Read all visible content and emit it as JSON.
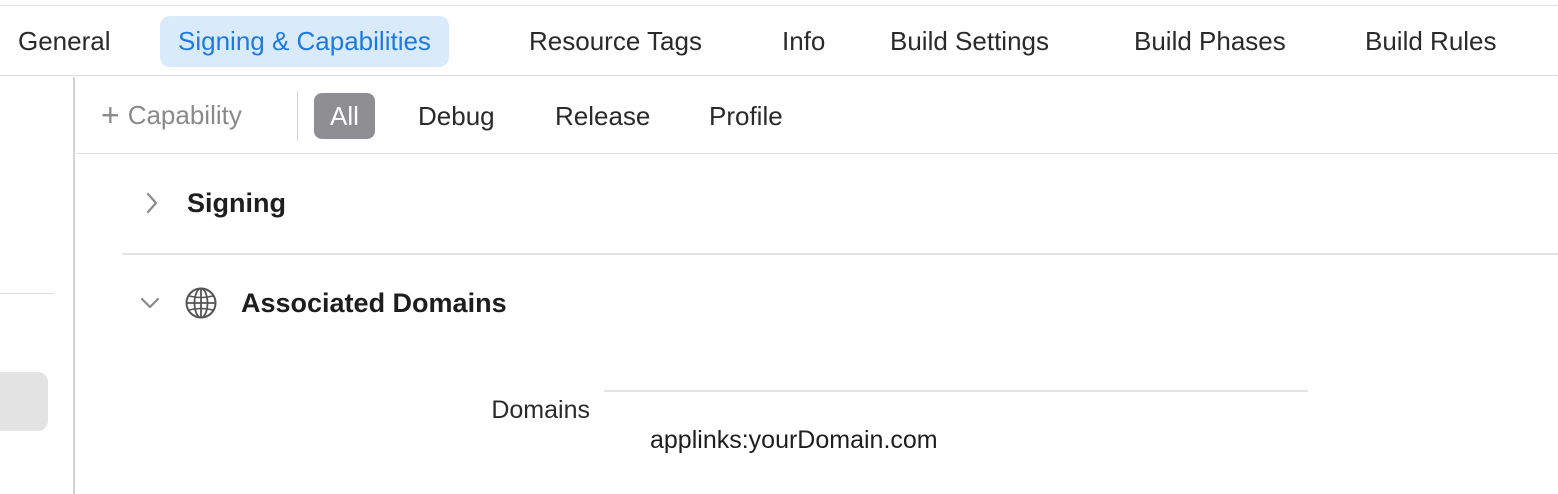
{
  "tabs": [
    {
      "label": "General",
      "active": false
    },
    {
      "label": "Signing & Capabilities",
      "active": true
    },
    {
      "label": "Resource Tags",
      "active": false
    },
    {
      "label": "Info",
      "active": false
    },
    {
      "label": "Build Settings",
      "active": false
    },
    {
      "label": "Build Phases",
      "active": false
    },
    {
      "label": "Build Rules",
      "active": false
    }
  ],
  "toolbar": {
    "add_capability_icon": "plus-icon",
    "add_capability_label": "Capability",
    "filters": [
      {
        "label": "All",
        "active": true
      },
      {
        "label": "Debug",
        "active": false
      },
      {
        "label": "Release",
        "active": false
      },
      {
        "label": "Profile",
        "active": false
      }
    ]
  },
  "sections": {
    "signing": {
      "title": "Signing",
      "expanded": false,
      "icon": "chevron-right-icon"
    },
    "associated_domains": {
      "title": "Associated Domains",
      "expanded": true,
      "icon": "globe-icon",
      "field_label": "Domains",
      "entries": [
        "applinks:yourDomain.com"
      ]
    }
  },
  "colors": {
    "accent": "#1f7ae0",
    "active_tab_bg": "#d9eafb",
    "active_filter_bg": "#8e8e93"
  }
}
